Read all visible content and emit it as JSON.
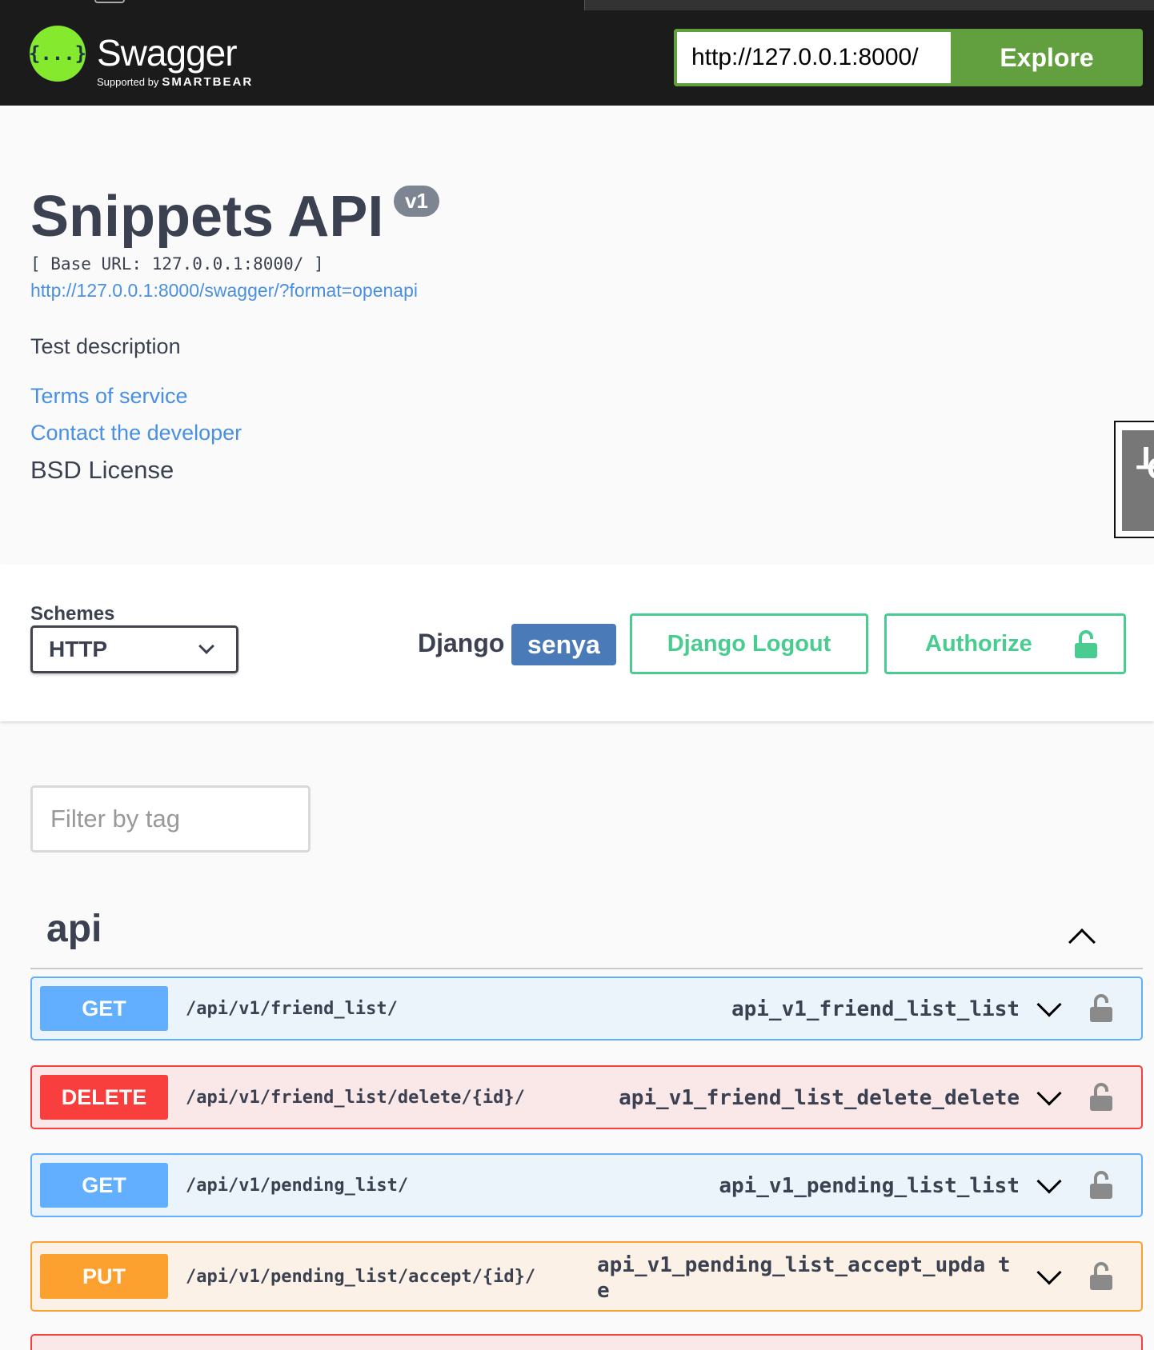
{
  "header": {
    "brand": "Swagger",
    "logo_glyph": "{...}",
    "supported_by": "Supported by",
    "vendor": "SMARTBEAR",
    "url_value": "http://127.0.0.1:8000/",
    "explore_label": "Explore"
  },
  "info": {
    "title": "Snippets API",
    "version": "v1",
    "base_url": "[ Base URL: 127.0.0.1:8000/ ]",
    "spec_link": "http://127.0.0.1:8000/swagger/?format=openapi",
    "description": "Test description",
    "terms": "Terms of service",
    "contact": "Contact the developer",
    "license": "BSD License"
  },
  "debug_toolbar": {
    "label_a": "D",
    "label_b": "j",
    "label_c": "DT"
  },
  "schemes": {
    "label": "Schemes",
    "selected": "HTTP"
  },
  "auth": {
    "django_label": "Django",
    "username": "senya",
    "logout_label": "Django Logout",
    "authorize_label": "Authorize"
  },
  "filter": {
    "placeholder": "Filter by tag"
  },
  "tag": {
    "name": "api"
  },
  "operations": [
    {
      "method": "GET",
      "path": "/api/v1/friend_list/",
      "operation_id": "api_v1_friend_list_list"
    },
    {
      "method": "DELETE",
      "path": "/api/v1/friend_list/delete/{id}/",
      "operation_id": "api_v1_friend_list_delete_delete"
    },
    {
      "method": "GET",
      "path": "/api/v1/pending_list/",
      "operation_id": "api_v1_pending_list_list"
    },
    {
      "method": "PUT",
      "path": "/api/v1/pending_list/accept/{id}/",
      "operation_id": "api_v1_pending_list_accept_upda te"
    }
  ],
  "colors": {
    "swagger_green": "#85ea2d",
    "explore_green": "#62a03f",
    "get_blue": "#61affe",
    "delete_red": "#f93e3e",
    "put_orange": "#fca130",
    "auth_green": "#49cc90",
    "user_badge": "#4a7ab8"
  },
  "icons": [
    "swagger-logo-icon",
    "chevron-down-icon",
    "lock-icon",
    "chevron-up-icon"
  ]
}
